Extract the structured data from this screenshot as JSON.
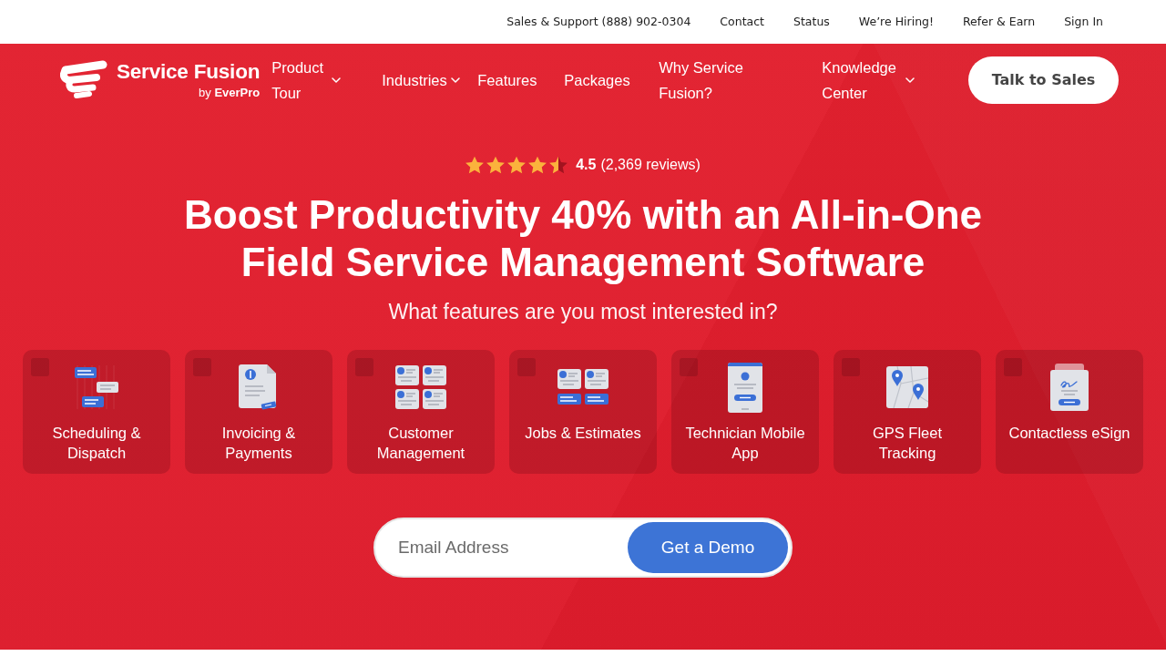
{
  "top_bar": {
    "links": [
      "Sales & Support (888) 902-0304",
      "Contact",
      "Status",
      "We’re Hiring!",
      "Refer & Earn",
      "Sign In"
    ]
  },
  "navbar": {
    "logo": {
      "name": "Service Fusion",
      "tagline": "by **EverPro**"
    },
    "items": [
      {
        "label": "Product Tour",
        "dropdown": true
      },
      {
        "label": "Industries",
        "dropdown": true
      },
      {
        "label": "Features",
        "dropdown": false
      },
      {
        "label": "Packages",
        "dropdown": false
      },
      {
        "label": "Why Service Fusion?",
        "dropdown": false
      },
      {
        "label": "Knowledge Center",
        "dropdown": true
      }
    ],
    "cta": "Talk to Sales"
  },
  "hero": {
    "rating": {
      "stars": 4.5,
      "score": "4.5",
      "count": "(2,369 reviews)"
    },
    "title": "Boost Productivity 40% with an All-in-One Field Service Management Software",
    "subtitle": "What features are you most interested in?",
    "features": [
      {
        "label": "Scheduling & Dispatch",
        "checked": false
      },
      {
        "label": "Invoicing & Payments",
        "checked": false
      },
      {
        "label": "Customer Management",
        "checked": false
      },
      {
        "label": "Jobs & Estimates",
        "checked": false
      },
      {
        "label": "Technician Mobile App",
        "checked": false
      },
      {
        "label": "GPS Fleet Tracking",
        "checked": false
      },
      {
        "label": "Contactless eSign",
        "checked": false
      }
    ],
    "email": {
      "placeholder": "Email Address"
    },
    "submit": "Get a Demo"
  }
}
